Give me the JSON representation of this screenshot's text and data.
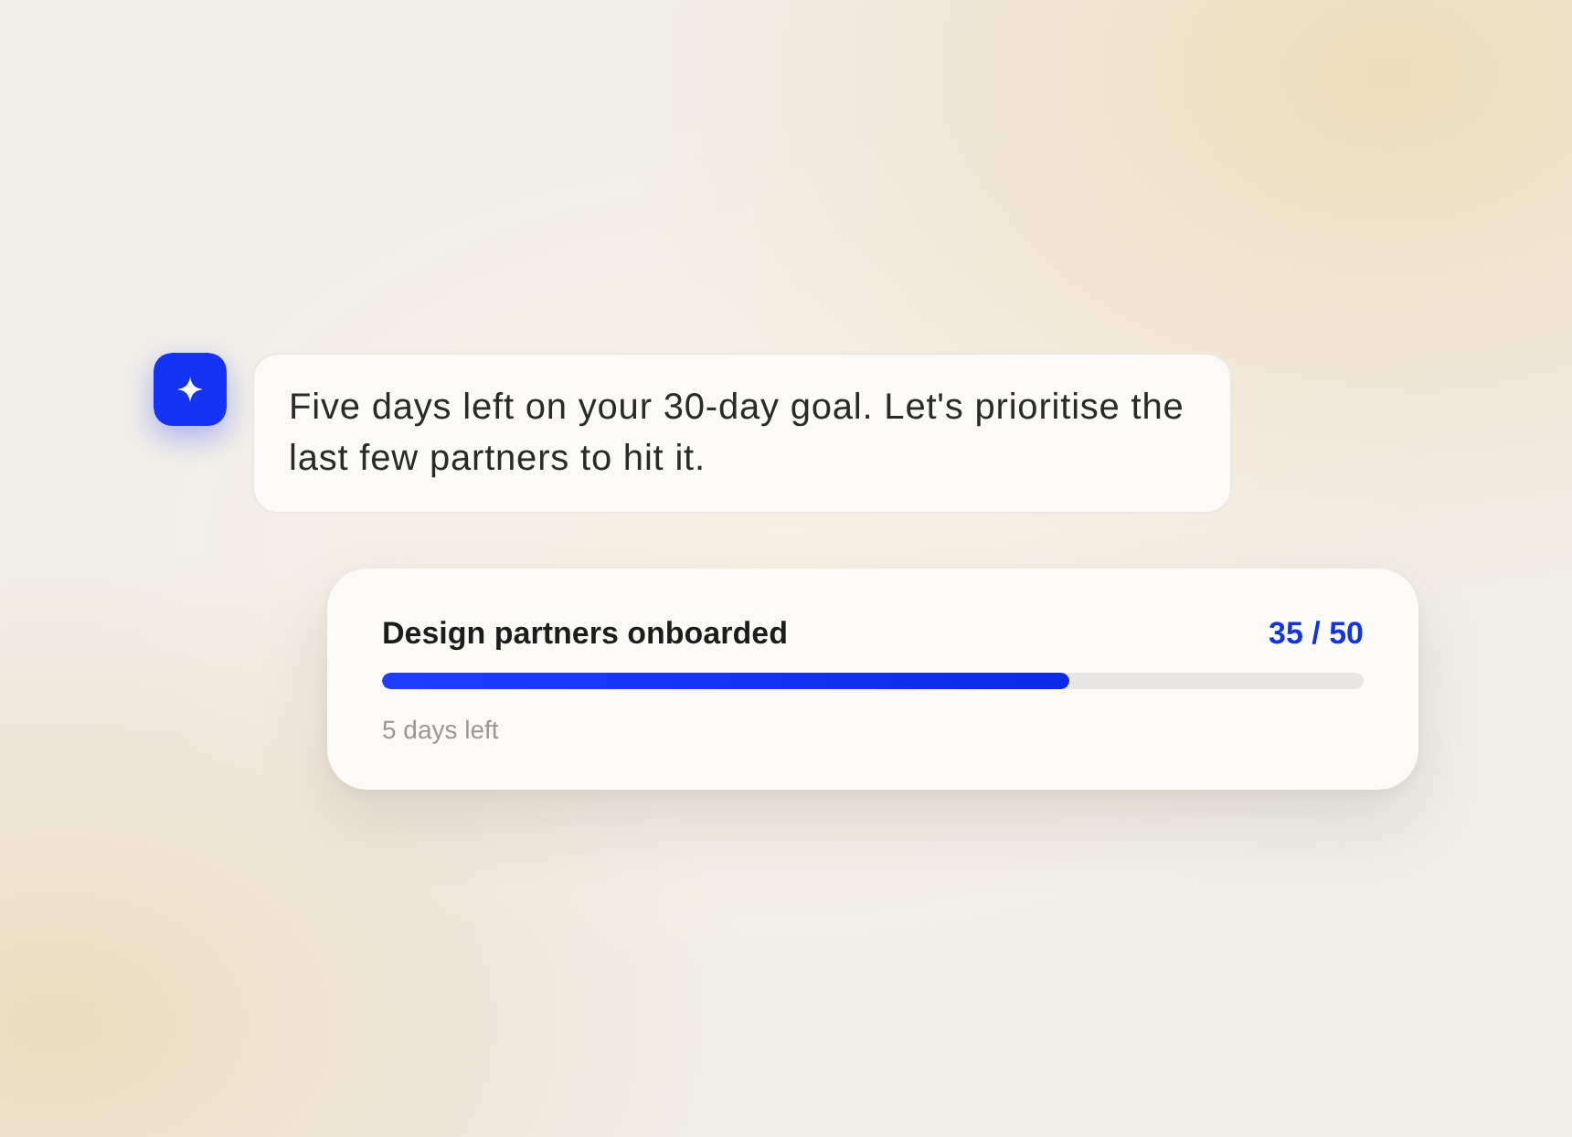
{
  "assistant": {
    "message": "Five days left on your 30-day goal. Let's prioritise the last few partners to hit it."
  },
  "goal_card": {
    "title": "Design partners onboarded",
    "count": "35 / 50",
    "progress": {
      "level": 0.7
    },
    "remaining": "5 days left"
  }
}
